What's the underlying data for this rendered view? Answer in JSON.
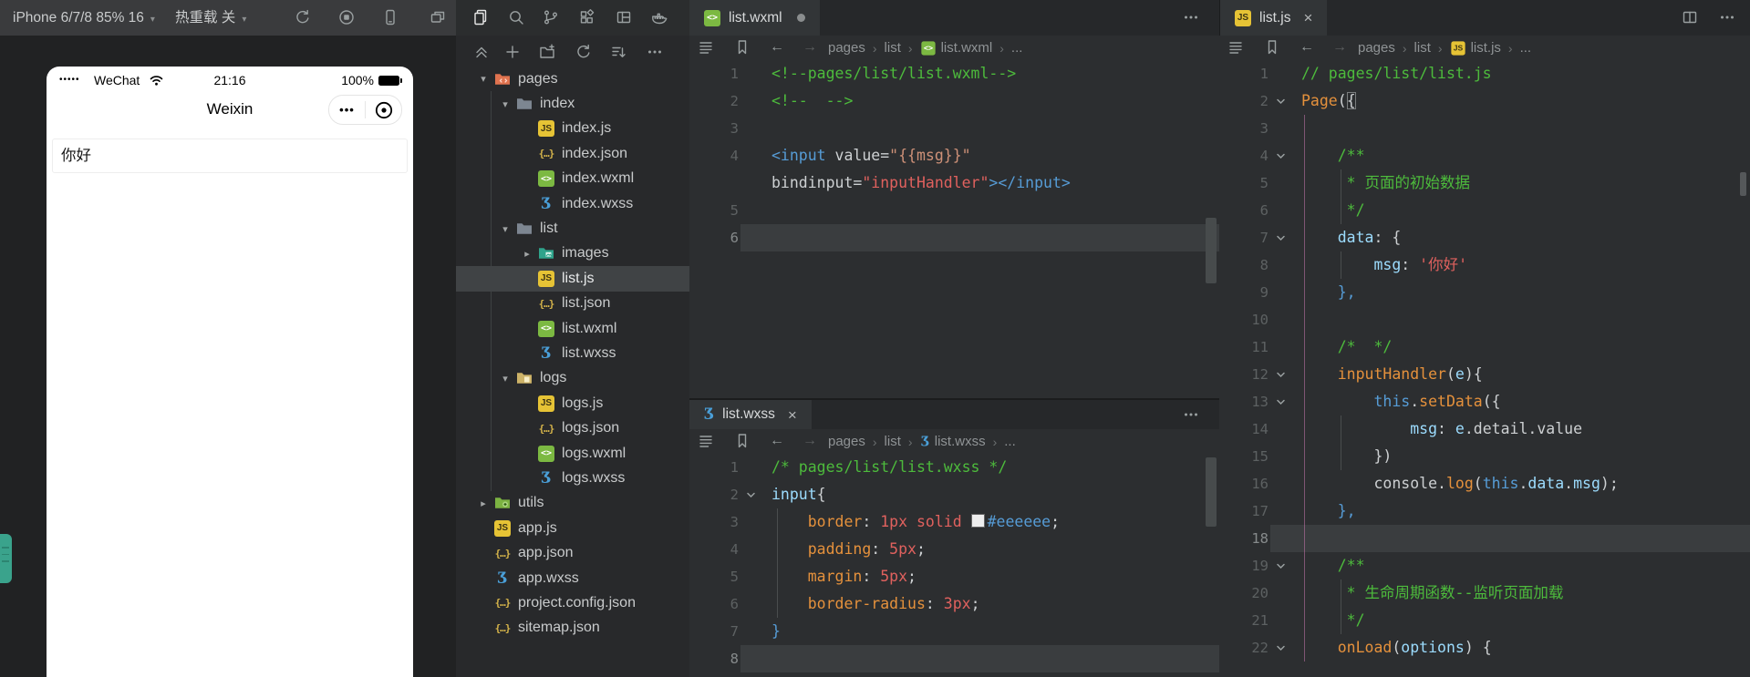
{
  "colors": {
    "syntax": {
      "comment": "#4dbb3c",
      "keyword": "#569cd6",
      "identifier": "#9cdcfe",
      "function": "#e5913c",
      "string": "#e0615e",
      "attr_value": "#ce9178",
      "plain": "#cdd0d2"
    },
    "ui": {
      "topbar_bg": "#3a3b3d",
      "editor_bg": "#2c2e30",
      "explorer_bg": "#28292b",
      "tab_strip_bg": "#26282a",
      "active_tab_bg": "#323537",
      "current_line": "#3a3d3f",
      "selected_row": "#404345",
      "edge_handle": "#3aa38c"
    }
  },
  "topbar": {
    "device_selector": "iPhone 6/7/8 85% 16",
    "hot_reload": "热重载 关",
    "sim_icons": [
      "refresh-icon",
      "record-icon",
      "device-icon",
      "windows-icon"
    ],
    "activity_icons": [
      "files-icon",
      "search-icon",
      "git-branch-icon",
      "extensions-icon",
      "layout-icon",
      "docker-icon"
    ]
  },
  "simulator": {
    "signal_dots": "•••••",
    "carrier": "WeChat",
    "time": "21:16",
    "battery_percent": "100%",
    "nav_title": "Weixin",
    "input_value": "你好"
  },
  "explorer": {
    "toolbar_icons": [
      "collapse-icon",
      "new-file-icon",
      "new-folder-icon",
      "refresh-icon",
      "sort-icon",
      "more-icon"
    ],
    "tree": [
      {
        "label": "pages",
        "level": 0,
        "kind": "folder",
        "icon": "folder-pages",
        "expanded": true
      },
      {
        "label": "index",
        "level": 1,
        "kind": "folder",
        "icon": "folder-plain",
        "expanded": true
      },
      {
        "label": "index.js",
        "level": 2,
        "kind": "file",
        "icon": "js"
      },
      {
        "label": "index.json",
        "level": 2,
        "kind": "file",
        "icon": "json"
      },
      {
        "label": "index.wxml",
        "level": 2,
        "kind": "file",
        "icon": "wxml"
      },
      {
        "label": "index.wxss",
        "level": 2,
        "kind": "file",
        "icon": "wxss"
      },
      {
        "label": "list",
        "level": 1,
        "kind": "folder",
        "icon": "folder-plain",
        "expanded": true
      },
      {
        "label": "images",
        "level": 2,
        "kind": "folder",
        "icon": "folder-images",
        "expanded": false
      },
      {
        "label": "list.js",
        "level": 2,
        "kind": "file",
        "icon": "js",
        "selected": true
      },
      {
        "label": "list.json",
        "level": 2,
        "kind": "file",
        "icon": "json"
      },
      {
        "label": "list.wxml",
        "level": 2,
        "kind": "file",
        "icon": "wxml"
      },
      {
        "label": "list.wxss",
        "level": 2,
        "kind": "file",
        "icon": "wxss"
      },
      {
        "label": "logs",
        "level": 1,
        "kind": "folder",
        "icon": "folder-logs",
        "expanded": true
      },
      {
        "label": "logs.js",
        "level": 2,
        "kind": "file",
        "icon": "js"
      },
      {
        "label": "logs.json",
        "level": 2,
        "kind": "file",
        "icon": "json"
      },
      {
        "label": "logs.wxml",
        "level": 2,
        "kind": "file",
        "icon": "wxml"
      },
      {
        "label": "logs.wxss",
        "level": 2,
        "kind": "file",
        "icon": "wxss"
      },
      {
        "label": "utils",
        "level": 0,
        "kind": "folder",
        "icon": "folder-utils",
        "expanded": false
      },
      {
        "label": "app.js",
        "level": 0,
        "kind": "file",
        "icon": "js"
      },
      {
        "label": "app.json",
        "level": 0,
        "kind": "file",
        "icon": "json"
      },
      {
        "label": "app.wxss",
        "level": 0,
        "kind": "file",
        "icon": "wxss"
      },
      {
        "label": "project.config.json",
        "level": 0,
        "kind": "file",
        "icon": "json"
      },
      {
        "label": "sitemap.json",
        "level": 0,
        "kind": "file",
        "icon": "json"
      }
    ]
  },
  "panels": {
    "wxml": {
      "tab": "list.wxml",
      "modified": true,
      "breadcrumb": [
        {
          "label": "pages"
        },
        {
          "label": "list"
        },
        {
          "label": "list.wxml",
          "icon": "wxml"
        },
        {
          "label": "..."
        }
      ],
      "lines": [
        {
          "n": "1",
          "t": [
            [
              "cm",
              "<!--pages/list/list.wxml-->"
            ]
          ]
        },
        {
          "n": "2",
          "t": [
            [
              "cm",
              "<!--  -->"
            ]
          ]
        },
        {
          "n": "3",
          "t": []
        },
        {
          "n": "4",
          "t": [
            [
              "kw",
              "<input"
            ],
            [
              "pl",
              " value="
            ],
            [
              "at",
              "\"{{msg}}\""
            ]
          ]
        },
        {
          "n": "",
          "t": [
            [
              "pl",
              "bindinput="
            ],
            [
              "st",
              "\"inputHandler\""
            ],
            [
              "kw",
              "></input>"
            ]
          ]
        },
        {
          "n": "5",
          "t": []
        },
        {
          "n": "6",
          "cur": true,
          "t": []
        }
      ]
    },
    "wxss": {
      "tab": "list.wxss",
      "breadcrumb": [
        {
          "label": "pages"
        },
        {
          "label": "list"
        },
        {
          "label": "list.wxss",
          "icon": "wxss"
        },
        {
          "label": "..."
        }
      ],
      "lines": [
        {
          "n": "1",
          "t": [
            [
              "cm",
              "/* pages/list/list.wxss */"
            ]
          ]
        },
        {
          "n": "2",
          "fold": true,
          "t": [
            [
              "id",
              "input"
            ],
            [
              "pl",
              "{"
            ]
          ]
        },
        {
          "n": "3",
          "t": [
            [
              "pl",
              "    "
            ],
            [
              "fn",
              "border"
            ],
            [
              "pl",
              ": "
            ],
            [
              "st",
              "1px solid "
            ],
            [
              "sw",
              ""
            ],
            [
              "kw",
              "#eeeeee"
            ],
            [
              "pl",
              ";"
            ]
          ]
        },
        {
          "n": "4",
          "t": [
            [
              "pl",
              "    "
            ],
            [
              "fn",
              "padding"
            ],
            [
              "pl",
              ": "
            ],
            [
              "st",
              "5px"
            ],
            [
              "pl",
              ";"
            ]
          ]
        },
        {
          "n": "5",
          "t": [
            [
              "pl",
              "    "
            ],
            [
              "fn",
              "margin"
            ],
            [
              "pl",
              ": "
            ],
            [
              "st",
              "5px"
            ],
            [
              "pl",
              ";"
            ]
          ]
        },
        {
          "n": "6",
          "t": [
            [
              "pl",
              "    "
            ],
            [
              "fn",
              "border-radius"
            ],
            [
              "pl",
              ": "
            ],
            [
              "st",
              "3px"
            ],
            [
              "pl",
              ";"
            ]
          ]
        },
        {
          "n": "7",
          "t": [
            [
              "kw",
              "}"
            ]
          ]
        },
        {
          "n": "8",
          "cur": true,
          "t": []
        }
      ]
    },
    "js": {
      "tab": "list.js",
      "breadcrumb": [
        {
          "label": "pages"
        },
        {
          "label": "list"
        },
        {
          "label": "list.js",
          "icon": "js"
        },
        {
          "label": "..."
        }
      ],
      "lines": [
        {
          "n": "1",
          "t": [
            [
              "cm",
              "// pages/list/list.js"
            ]
          ]
        },
        {
          "n": "2",
          "fold": true,
          "t": [
            [
              "fn",
              "Page"
            ],
            [
              "pl",
              "("
            ],
            [
              "plm",
              "{"
            ]
          ]
        },
        {
          "n": "3",
          "t": []
        },
        {
          "n": "4",
          "fold": true,
          "t": [
            [
              "pl",
              "    "
            ],
            [
              "cm",
              "/**"
            ]
          ]
        },
        {
          "n": "5",
          "t": [
            [
              "pl",
              "    "
            ],
            [
              "cm",
              " * 页面的初始数据"
            ]
          ]
        },
        {
          "n": "6",
          "t": [
            [
              "pl",
              "    "
            ],
            [
              "cm",
              " */"
            ]
          ]
        },
        {
          "n": "7",
          "fold": true,
          "t": [
            [
              "pl",
              "    "
            ],
            [
              "id",
              "data"
            ],
            [
              "pl",
              ": {"
            ]
          ]
        },
        {
          "n": "8",
          "t": [
            [
              "pl",
              "        "
            ],
            [
              "id",
              "msg"
            ],
            [
              "pl",
              ": "
            ],
            [
              "st",
              "'你好'"
            ]
          ]
        },
        {
          "n": "9",
          "t": [
            [
              "pl",
              "    "
            ],
            [
              "kw",
              "},"
            ]
          ]
        },
        {
          "n": "10",
          "t": []
        },
        {
          "n": "11",
          "t": [
            [
              "pl",
              "    "
            ],
            [
              "cm",
              "/*  */"
            ]
          ]
        },
        {
          "n": "12",
          "fold": true,
          "t": [
            [
              "pl",
              "    "
            ],
            [
              "fn",
              "inputHandler"
            ],
            [
              "pl",
              "("
            ],
            [
              "id",
              "e"
            ],
            [
              "pl",
              "){"
            ]
          ]
        },
        {
          "n": "13",
          "fold": true,
          "t": [
            [
              "pl",
              "        "
            ],
            [
              "kw",
              "this"
            ],
            [
              "pl",
              "."
            ],
            [
              "fn",
              "setData"
            ],
            [
              "pl",
              "({"
            ]
          ]
        },
        {
          "n": "14",
          "t": [
            [
              "pl",
              "            "
            ],
            [
              "id",
              "msg"
            ],
            [
              "pl",
              ": "
            ],
            [
              "id",
              "e"
            ],
            [
              "pl",
              "."
            ],
            [
              "pl",
              "detail"
            ],
            [
              "pl",
              "."
            ],
            [
              "pl",
              "value"
            ]
          ]
        },
        {
          "n": "15",
          "t": [
            [
              "pl",
              "        "
            ],
            [
              "pl",
              "})"
            ]
          ]
        },
        {
          "n": "16",
          "t": [
            [
              "pl",
              "        "
            ],
            [
              "pl",
              "console"
            ],
            [
              "pl",
              "."
            ],
            [
              "fn",
              "log"
            ],
            [
              "pl",
              "("
            ],
            [
              "kw",
              "this"
            ],
            [
              "pl",
              "."
            ],
            [
              "id",
              "data"
            ],
            [
              "pl",
              "."
            ],
            [
              "id",
              "msg"
            ],
            [
              "pl",
              ");"
            ]
          ]
        },
        {
          "n": "17",
          "t": [
            [
              "pl",
              "    "
            ],
            [
              "kw",
              "},"
            ]
          ]
        },
        {
          "n": "18",
          "cur": true,
          "t": []
        },
        {
          "n": "19",
          "fold": true,
          "t": [
            [
              "pl",
              "    "
            ],
            [
              "cm",
              "/**"
            ]
          ]
        },
        {
          "n": "20",
          "t": [
            [
              "pl",
              "    "
            ],
            [
              "cm",
              " * 生命周期函数--监听页面加载"
            ]
          ]
        },
        {
          "n": "21",
          "t": [
            [
              "pl",
              "    "
            ],
            [
              "cm",
              " */"
            ]
          ]
        },
        {
          "n": "22",
          "fold": true,
          "t": [
            [
              "pl",
              "    "
            ],
            [
              "fn",
              "onLoad"
            ],
            [
              "pl",
              "("
            ],
            [
              "id",
              "options"
            ],
            [
              "pl",
              ") {"
            ]
          ]
        }
      ]
    }
  }
}
